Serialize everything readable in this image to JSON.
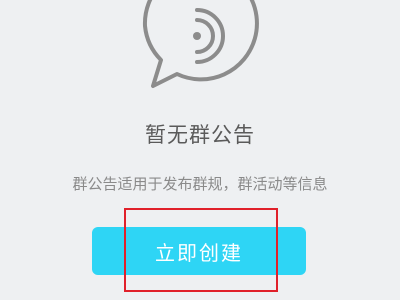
{
  "empty_state": {
    "icon": "announcement-bubble-icon",
    "title": "暂无群公告",
    "description": "群公告适用于发布群规，群活动等信息"
  },
  "actions": {
    "create_label": "立即创建"
  },
  "colors": {
    "background": "#eef0f2",
    "button": "#2ed5f5",
    "icon_stroke": "#8c8c8c",
    "highlight": "#e0202a"
  }
}
